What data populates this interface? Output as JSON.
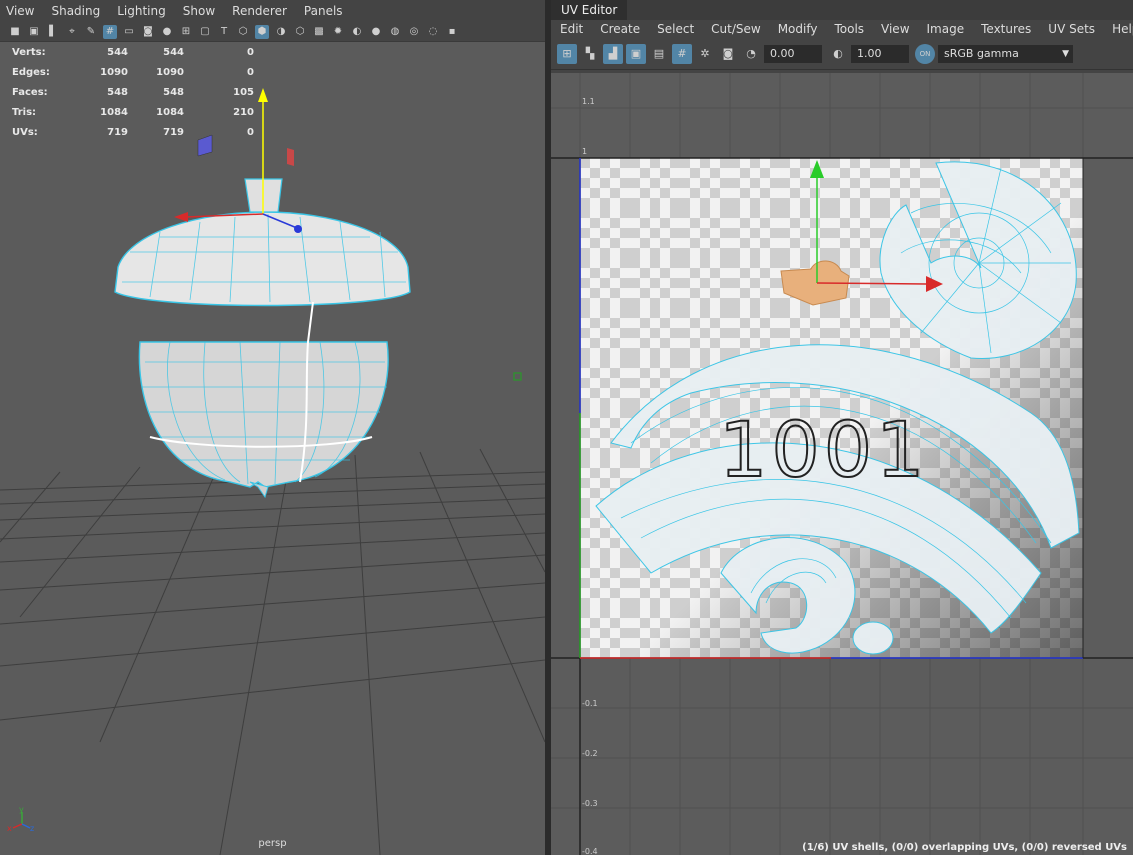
{
  "left_menu": [
    "View",
    "Shading",
    "Lighting",
    "Show",
    "Renderer",
    "Panels"
  ],
  "hud": {
    "rows": [
      {
        "label": "Verts:",
        "a": "544",
        "b": "544",
        "c": "0"
      },
      {
        "label": "Edges:",
        "a": "1090",
        "b": "1090",
        "c": "0"
      },
      {
        "label": "Faces:",
        "a": "548",
        "b": "548",
        "c": "105"
      },
      {
        "label": "Tris:",
        "a": "1084",
        "b": "1084",
        "c": "210"
      },
      {
        "label": "UVs:",
        "a": "719",
        "b": "719",
        "c": "0"
      }
    ]
  },
  "camera_label": "persp",
  "axis_labels": {
    "y": "y",
    "x": "x",
    "z": "z"
  },
  "uv_editor": {
    "title": "UV Editor",
    "menu": [
      "Edit",
      "Create",
      "Select",
      "Cut/Sew",
      "Modify",
      "Tools",
      "View",
      "Image",
      "Textures",
      "UV Sets",
      "Help"
    ],
    "exposure": "0.00",
    "gamma": "1.00",
    "color_space_toggle": "ON",
    "color_space": "sRGB gamma",
    "ticks": [
      "1.1",
      "1",
      "-0.1",
      "-0.2",
      "-0.3",
      "-0.4"
    ],
    "udim_label": "1001",
    "status": "(1/6) UV shells, (0/0) overlapping UVs, (0/0) reversed UVs"
  },
  "colors": {
    "wire": "#39c5e6",
    "uv_fill": "#e8eff3",
    "selection": "#e8b07c"
  }
}
